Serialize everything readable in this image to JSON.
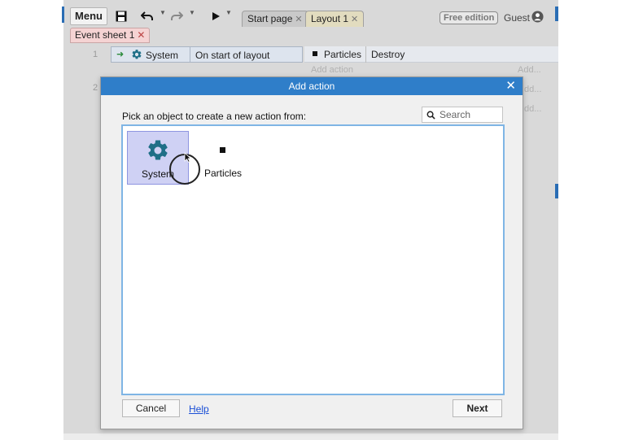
{
  "toolbar": {
    "menu_label": "Menu",
    "tabs": [
      {
        "label": "Start page"
      },
      {
        "label": "Layout 1"
      }
    ],
    "free_badge": "Free edition",
    "user_label": "Guest"
  },
  "sheet_tab": {
    "label": "Event sheet 1"
  },
  "events": [
    {
      "number": "1",
      "condition_object": "System",
      "condition": "On start of layout",
      "action_object": "Particles",
      "action": "Destroy",
      "add_action": "Add action"
    },
    {
      "number": "2"
    }
  ],
  "margin_add_labels": [
    "Add...",
    "dd...",
    "dd..."
  ],
  "dialog": {
    "title": "Add action",
    "prompt": "Pick an object to create a new action from:",
    "search_placeholder": "Search",
    "objects": [
      {
        "label": "System",
        "icon": "gear-icon",
        "selected": true
      },
      {
        "label": "Particles",
        "icon": "particles-icon",
        "selected": false
      }
    ],
    "cancel_label": "Cancel",
    "help_label": "Help",
    "next_label": "Next"
  },
  "colors": {
    "dialog_title_bar": "#2f7ec9",
    "selection": "#cfd1f4",
    "system_icon": "#1f6f87",
    "list_border": "#7fb5e5",
    "event_sheet_tab": "#f5d3d3"
  }
}
